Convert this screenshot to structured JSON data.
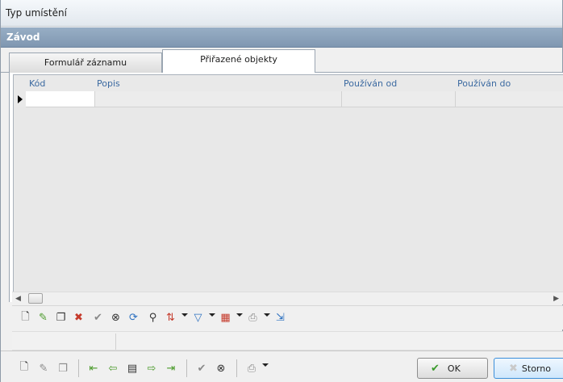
{
  "window": {
    "title": "Typ umístění"
  },
  "section": {
    "title": "Závod"
  },
  "tabs": [
    {
      "label": "Formulář záznamu",
      "active": false
    },
    {
      "label": "Přiřazené objekty",
      "active": true
    }
  ],
  "grid": {
    "columns": [
      "Kód",
      "Popis",
      "Používán od",
      "Používán do"
    ],
    "rows": [
      [
        "",
        "",
        "",
        ""
      ]
    ]
  },
  "grid_toolbar": {
    "icons": [
      "new-record-icon",
      "edit-record-icon",
      "copy-record-icon",
      "delete-record-icon",
      "confirm-icon",
      "cancel-icon",
      "refresh-icon",
      "find-icon",
      "sort-icon",
      "filter-icon",
      "columns-icon",
      "print-icon",
      "export-icon"
    ]
  },
  "bottom_toolbar": {
    "icons": [
      "new-icon",
      "edit-icon",
      "delete-icon",
      "first-icon",
      "previous-icon",
      "detail-icon",
      "next-icon",
      "last-icon",
      "confirm-icon",
      "cancel-icon",
      "print-icon"
    ]
  },
  "buttons": {
    "ok_label": "OK",
    "cancel_label": "Storno"
  },
  "colors": {
    "section_header": "#8ea5bd",
    "header_text": "#3c6aa1",
    "accent": "#3c8fd9"
  }
}
